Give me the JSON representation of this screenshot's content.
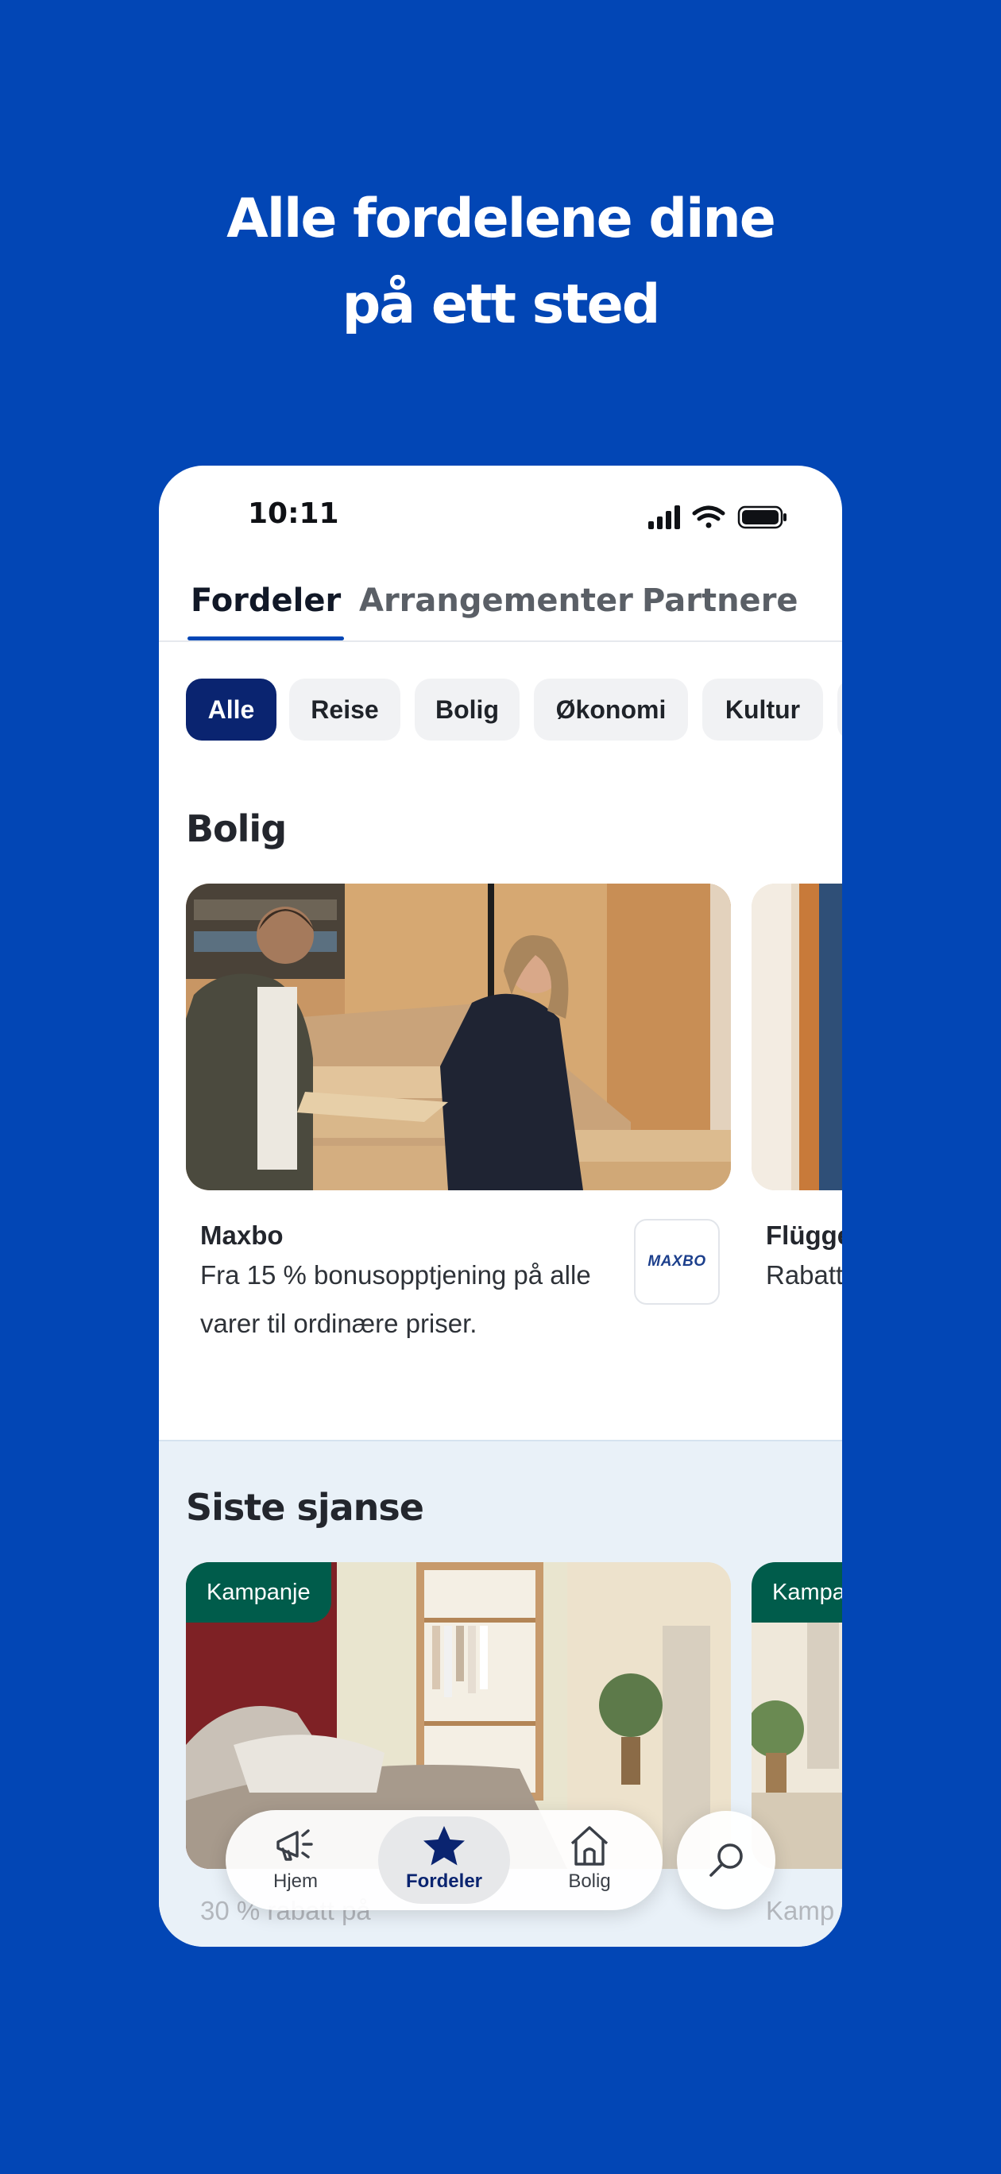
{
  "headline": {
    "line1": "Alle fordelene dine",
    "line2": "på ett sted"
  },
  "status": {
    "time": "10:11"
  },
  "tabs": [
    {
      "label": "Fordeler",
      "active": true
    },
    {
      "label": "Arrangementer",
      "active": false
    },
    {
      "label": "Partnere",
      "active": false
    }
  ],
  "chips": [
    {
      "label": "Alle",
      "active": true
    },
    {
      "label": "Reise",
      "active": false
    },
    {
      "label": "Bolig",
      "active": false
    },
    {
      "label": "Økonomi",
      "active": false
    },
    {
      "label": "Kultur",
      "active": false
    }
  ],
  "bolig": {
    "title": "Bolig",
    "cards": [
      {
        "name": "Maxbo",
        "description": "Fra 15 % bonusopptjening på alle varer til ordinære priser.",
        "logo_text": "MAXBO"
      },
      {
        "name": "Flügge",
        "description": "Rabatt interiø"
      }
    ]
  },
  "siste_sjanse": {
    "title": "Siste sjanse",
    "cards": [
      {
        "badge": "Kampanje",
        "subtitle": "30 % rabatt på"
      },
      {
        "badge": "Kampanje",
        "subtitle": "Kamp"
      }
    ]
  },
  "bottom_nav": [
    {
      "label": "Hjem",
      "icon": "megaphone-icon",
      "active": false
    },
    {
      "label": "Fordeler",
      "icon": "star-icon",
      "active": true
    },
    {
      "label": "Bolig",
      "icon": "house-icon",
      "active": false
    }
  ],
  "colors": {
    "background": "#0246b5",
    "active_chip": "#0a2470",
    "badge": "#005c4b",
    "section_bg": "#e9f1f8"
  }
}
